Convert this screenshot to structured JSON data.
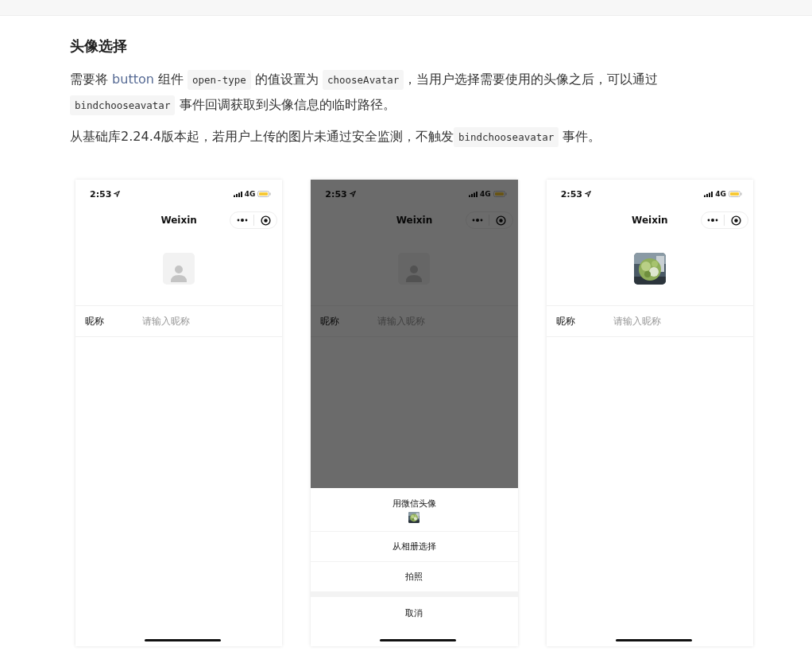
{
  "section": {
    "heading": "头像选择",
    "paragraphs": [
      [
        {
          "kind": "text",
          "text": "需要将 "
        },
        {
          "kind": "link",
          "text": "button"
        },
        {
          "kind": "text",
          "text": " 组件 "
        },
        {
          "kind": "code",
          "text": "open-type"
        },
        {
          "kind": "text",
          "text": " 的值设置为 "
        },
        {
          "kind": "code",
          "text": "chooseAvatar"
        },
        {
          "kind": "text",
          "text": "，当用户选择需要使用的头像之后，可以通过 "
        },
        {
          "kind": "code",
          "text": "bindchooseavatar"
        },
        {
          "kind": "text",
          "text": " 事件回调获取到头像信息的临时路径。"
        }
      ],
      [
        {
          "kind": "text",
          "text": "从基础库2.24.4版本起，若用户上传的图片未通过安全监测，不触发"
        },
        {
          "kind": "code",
          "text": "bindchooseavatar"
        },
        {
          "kind": "text",
          "text": " 事件。"
        }
      ]
    ]
  },
  "phones": [
    {
      "time": "2:53",
      "network": "4G",
      "title": "Weixin",
      "avatar": {
        "kind": "placeholder"
      },
      "field": {
        "label": "昵称",
        "placeholder": "请输入昵称"
      }
    },
    {
      "time": "2:53",
      "network": "4G",
      "title": "Weixin",
      "avatar": {
        "kind": "placeholder"
      },
      "field": {
        "label": "昵称",
        "placeholder": "请输入昵称"
      },
      "sheet": {
        "options": [
          {
            "kind": "picture",
            "label": "用微信头像"
          },
          {
            "kind": "text",
            "label": "从相册选择"
          },
          {
            "kind": "text",
            "label": "拍照"
          }
        ],
        "cancel": "取消"
      }
    },
    {
      "time": "2:53",
      "network": "4G",
      "title": "Weixin",
      "field": {
        "label": "昵称",
        "placeholder": "请输入昵称"
      }
    }
  ]
}
